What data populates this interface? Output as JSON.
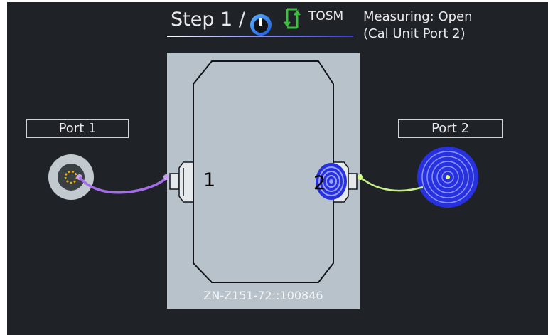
{
  "header": {
    "step_label": "Step 1 /",
    "method_label": "TOSM",
    "status_line1": "Measuring: Open",
    "status_line2": "(Cal Unit Port 2)"
  },
  "ports": {
    "port1_label": "Port 1",
    "port2_label": "Port 2"
  },
  "cal_unit": {
    "port1_number": "1",
    "port2_number": "2",
    "serial": "ZN-Z151-72::100846"
  },
  "colors": {
    "background": "#1f2327",
    "panel": "#b8c2ca",
    "cable_port1": "#a56ee8",
    "cable_port2": "#c7ef8a",
    "active_connector": "#2731e0",
    "cycle_icon": "#3fbf3f"
  },
  "icons": [
    "dial-icon",
    "cycle-icon",
    "port1-connector-icon",
    "port2-connector-icon",
    "cal-unit-connector-1-icon",
    "cal-unit-connector-2-icon"
  ]
}
